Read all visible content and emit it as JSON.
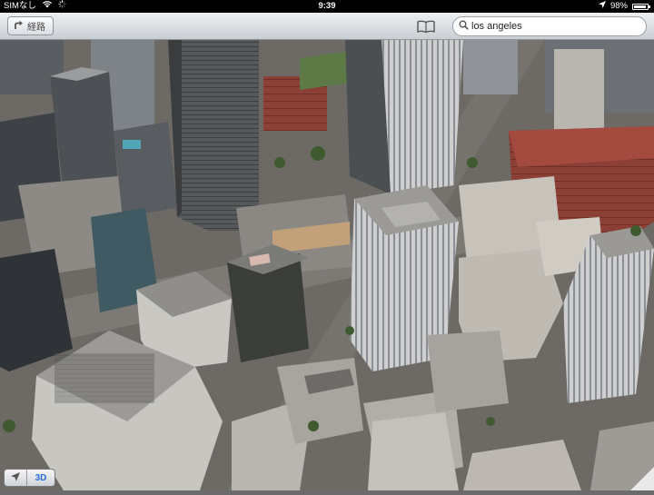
{
  "status_bar": {
    "carrier": "SIMなし",
    "time": "9:39",
    "battery": "98%"
  },
  "toolbar": {
    "directions_label": "経路"
  },
  "search": {
    "value": "los angeles"
  },
  "map_controls": {
    "mode_3d_label": "3D"
  }
}
